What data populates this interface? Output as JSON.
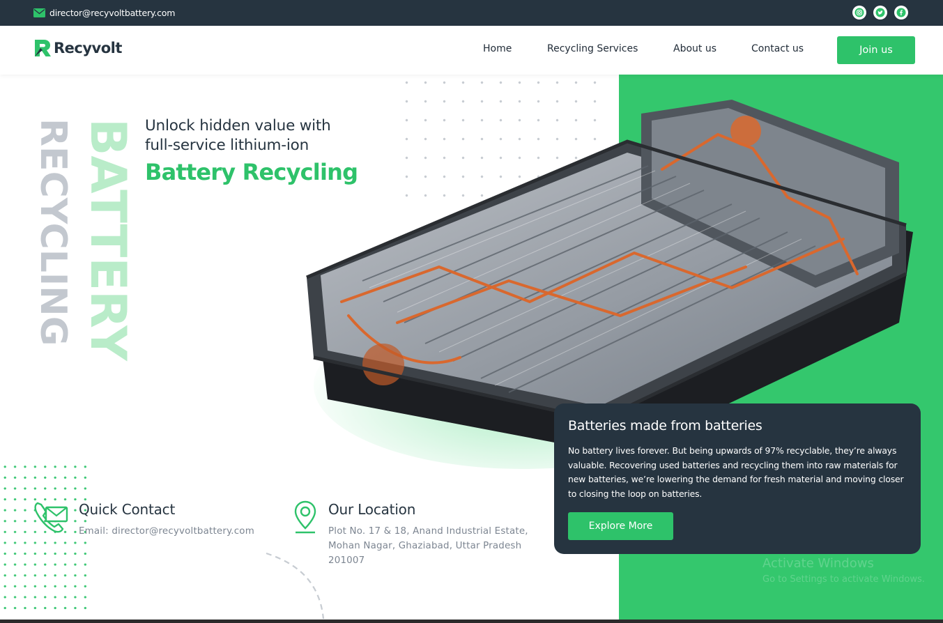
{
  "topbar": {
    "email": "director@recyvoltbattery.com",
    "social": [
      "instagram-icon",
      "twitter-icon",
      "facebook-icon"
    ]
  },
  "brand": {
    "name": "Recyvolt"
  },
  "nav": {
    "links": [
      "Home",
      "Recycling Services",
      "About us",
      "Contact us"
    ],
    "cta": "Join us"
  },
  "hero": {
    "vertical_gray": "RECYCLING",
    "vertical_green": "BATTERY",
    "line1": "Unlock hidden value with",
    "line2": "full-service lithium-ion",
    "accent": "Battery Recycling"
  },
  "card": {
    "title": "Batteries made from batteries",
    "body": "No battery lives forever. But being upwards of 97% recyclable, they’re always valuable. Recovering used batteries and recycling them into raw materials for new batteries, we’re lowering the demand for fresh material and moving closer to closing the loop on batteries.",
    "button": "Explore More"
  },
  "contact": {
    "title": "Quick Contact",
    "text": "Email: director@recyvoltbattery.com"
  },
  "location": {
    "title": "Our Location",
    "line1": "Plot No. 17 & 18, Anand Industrial Estate,",
    "line2": "Mohan Nagar, Ghaziabad, Uttar Pradesh",
    "line3": "201007"
  },
  "system_overlay": {
    "line1": "Activate Windows",
    "line2": "Go to Settings to activate Windows."
  },
  "colors": {
    "brand_green": "#2ec26a",
    "panel_green": "#34c76d",
    "dark_navy": "#263440"
  }
}
